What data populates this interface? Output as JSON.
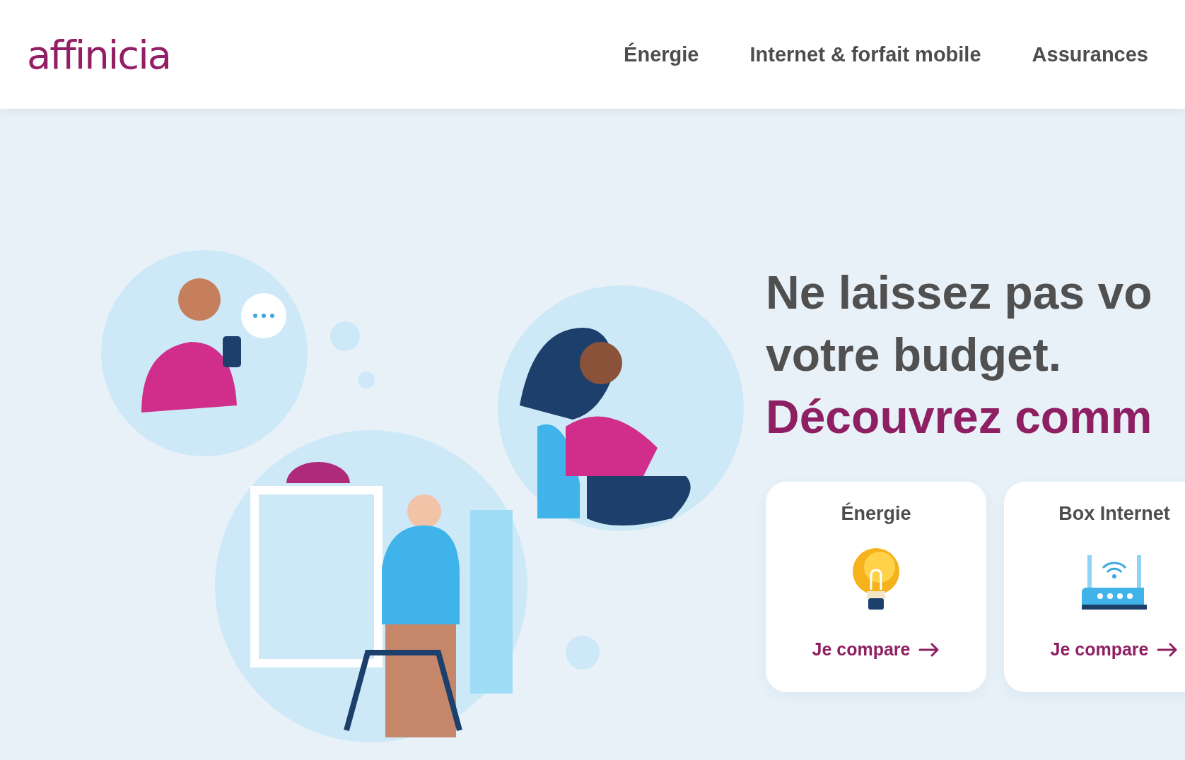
{
  "header": {
    "logo": "affinicia",
    "nav": [
      {
        "label": "Énergie"
      },
      {
        "label": "Internet & forfait mobile"
      },
      {
        "label": "Assurances"
      }
    ]
  },
  "hero": {
    "headline_lines": [
      "Ne laissez pas vo",
      "votre budget."
    ],
    "highlight": "Découvrez comm",
    "cards": [
      {
        "kind": "bulb",
        "title": "Énergie",
        "link": "Je compare"
      },
      {
        "kind": "router",
        "title": "Box Internet",
        "link": "Je compare"
      }
    ]
  }
}
